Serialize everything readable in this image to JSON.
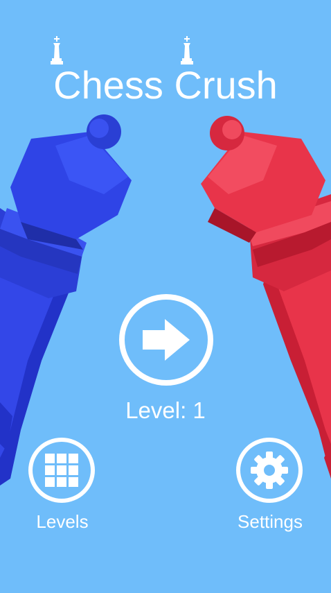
{
  "app": {
    "title": "Chess Crush",
    "level_text": "Level: 1"
  },
  "buttons": {
    "play_icon": "arrow-right-icon",
    "levels_label": "Levels",
    "levels_icon": "grid-icon",
    "settings_label": "Settings",
    "settings_icon": "gear-icon"
  },
  "colors": {
    "background": "#6fbdfa",
    "blue_queen": "#2f44e6",
    "red_queen": "#e8344a",
    "foreground": "#ffffff"
  }
}
